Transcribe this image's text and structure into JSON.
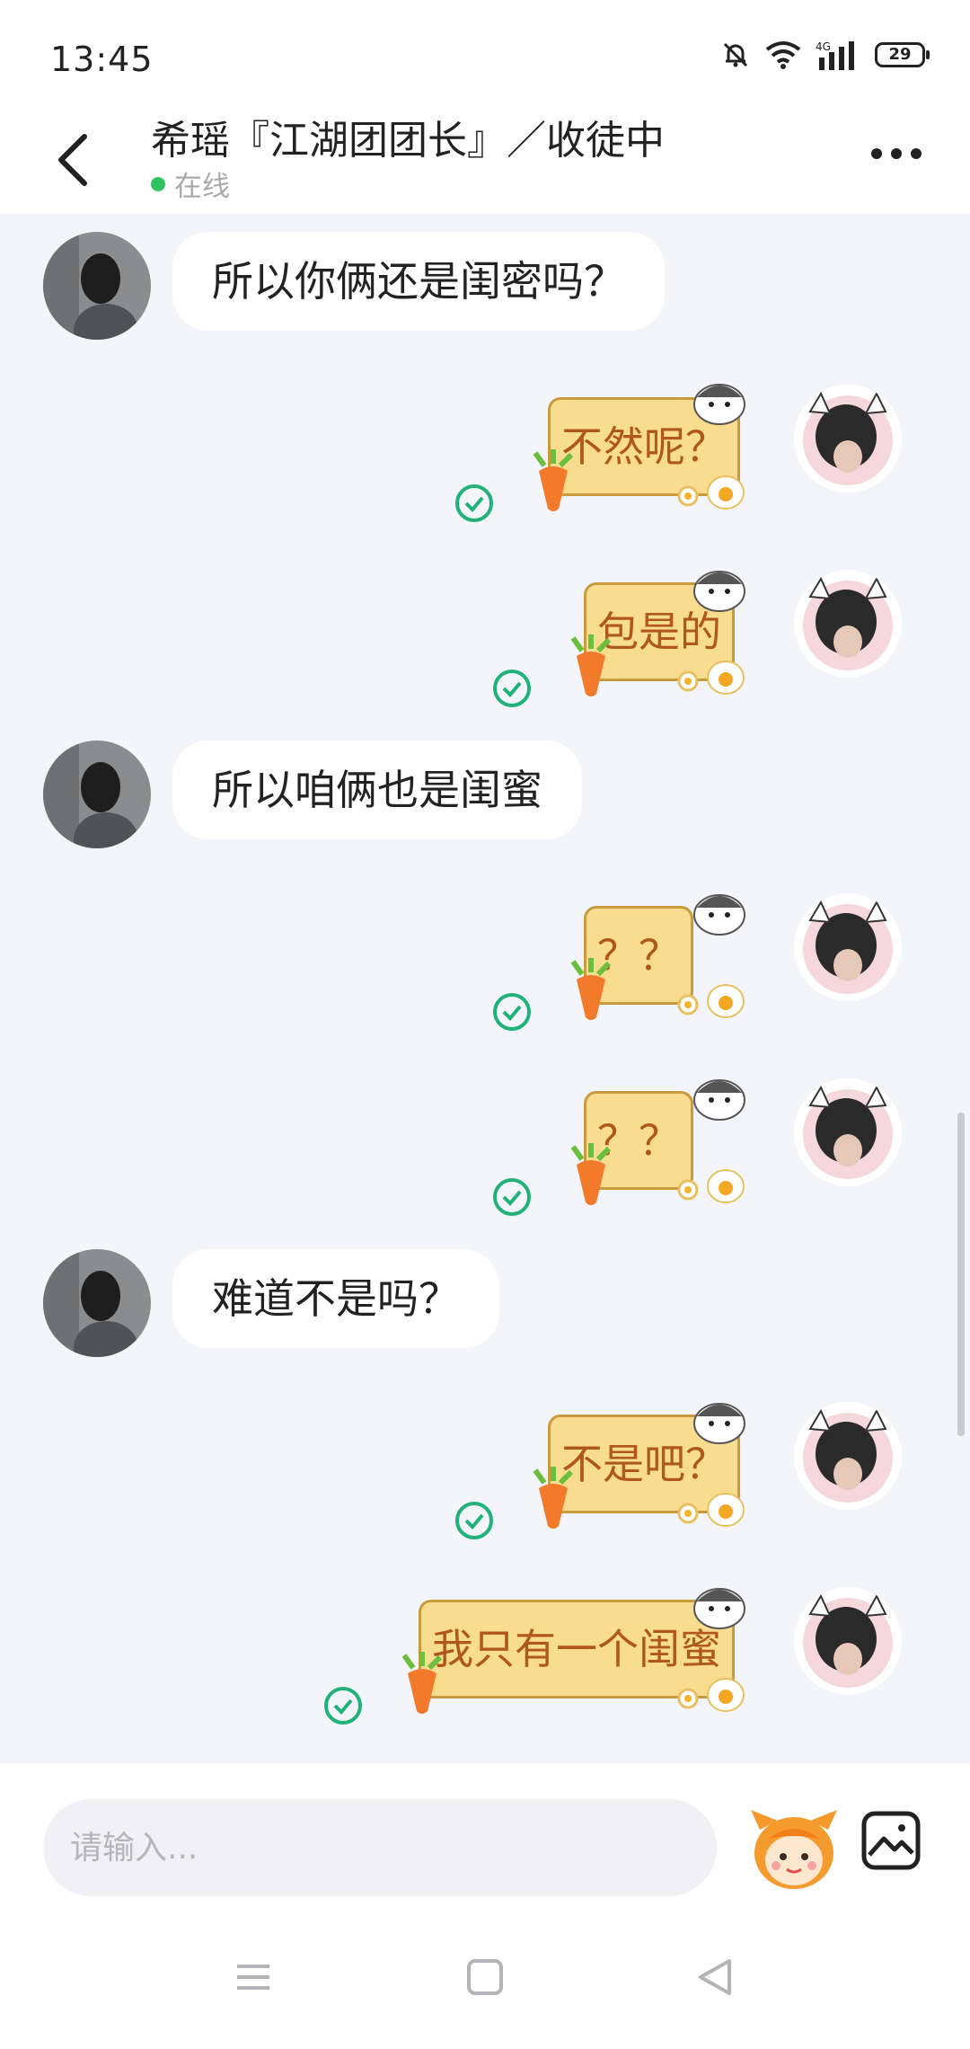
{
  "status_bar": {
    "time": "13:45",
    "battery": "29",
    "network": "4G"
  },
  "header": {
    "title": "希瑶『江湖团团长』／收徒中",
    "status": "在线"
  },
  "messages": [
    {
      "side": "in",
      "text": "所以你俩还是闺密吗？"
    },
    {
      "side": "out",
      "text": "不然呢？"
    },
    {
      "side": "out",
      "text": "包是的"
    },
    {
      "side": "in",
      "text": "所以咱俩也是闺蜜"
    },
    {
      "side": "out",
      "text": "？？"
    },
    {
      "side": "out",
      "text": "？？"
    },
    {
      "side": "in",
      "text": "难道不是吗？"
    },
    {
      "side": "out",
      "text": "不是吧？"
    },
    {
      "side": "out",
      "text": "我只有一个闺蜜"
    }
  ],
  "input": {
    "placeholder": "请输入..."
  },
  "icons": {
    "back": "chevron-left-icon",
    "more": "more-dots-icon",
    "mute": "bell-off-icon",
    "wifi": "wifi-icon",
    "signal": "signal-icon",
    "battery": "battery-icon",
    "mascot": "mascot-icon",
    "image": "image-icon",
    "read": "check-circle-icon",
    "nav_menu": "menu-icon",
    "nav_home": "home-square-icon",
    "nav_back": "back-triangle-icon"
  },
  "colors": {
    "accent_green": "#2fc461",
    "check_green": "#21b27a",
    "sticker_fill": "#f8dc90",
    "sticker_text": "#b0571c",
    "background": "#f3f5fa"
  }
}
